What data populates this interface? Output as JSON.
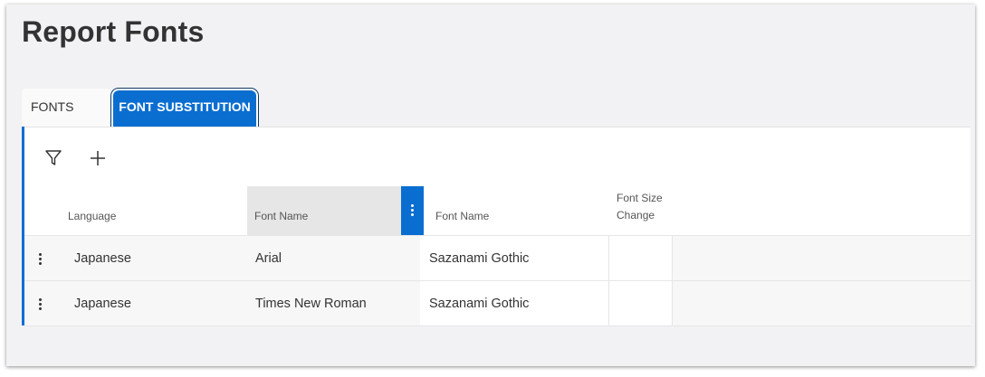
{
  "page": {
    "title": "Report Fonts"
  },
  "tabs": [
    {
      "label": "FONTS",
      "active": false
    },
    {
      "label": "FONT SUBSTITUTION",
      "active": true
    }
  ],
  "toolbar": {
    "filter_icon": "filter-icon",
    "add_icon": "plus-icon"
  },
  "table": {
    "columns": [
      "Language",
      "Font Name",
      "Font Name",
      "Font Size Change"
    ],
    "rows": [
      {
        "language": "Japanese",
        "font_name": "Arial",
        "substitute_font": "Sazanami Gothic",
        "size_change": ""
      },
      {
        "language": "Japanese",
        "font_name": "Times New Roman",
        "substitute_font": "Sazanami Gothic",
        "size_change": ""
      }
    ]
  },
  "colors": {
    "accent": "#0a6ed1",
    "background": "#f2f2f4",
    "header_active": "#e6e6e6"
  }
}
